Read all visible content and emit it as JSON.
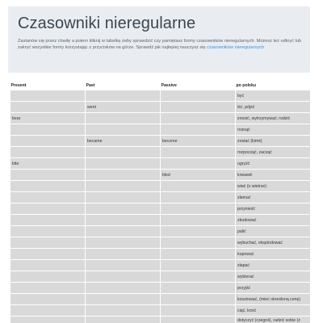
{
  "header": {
    "title": "Czasowniki nieregularne",
    "description": "Zastanów się przez chwilę a potem kliknij w tabelkę żeby sprawdzić czy pamiętasz formy czasowników nieregularnych. Możesz też odkryć lub zakryć wszystkie formy korzystając z przycisków na górze. Sprawdź jak najlepiej nauczysz się",
    "link_text": "czasowników nieregularnych"
  },
  "table": {
    "headers": [
      "Present",
      "Past",
      "Passive",
      "po polsku"
    ],
    "rows": [
      [
        "",
        "",
        "",
        "być"
      ],
      [
        "",
        "went",
        "",
        "iść, pójść"
      ],
      [
        "bear",
        "",
        "",
        "znosić, wytrzymywać; rodzić"
      ],
      [
        "",
        "",
        "",
        "rosnąć"
      ],
      [
        "",
        "became",
        "become",
        "zostać (kimś)"
      ],
      [
        "",
        "",
        "",
        "rozpocząć, zacząć"
      ],
      [
        "bite",
        "",
        "",
        "ugryźć"
      ],
      [
        "",
        "",
        "bled",
        "krwawić"
      ],
      [
        "",
        "",
        "",
        "wiać (o wietrze)"
      ],
      [
        "",
        "",
        "",
        "złamać"
      ],
      [
        "",
        "",
        "",
        "przynieść"
      ],
      [
        "",
        "",
        "",
        "zbudować"
      ],
      [
        "",
        "",
        "",
        "palić"
      ],
      [
        "",
        "",
        "",
        "wybuchać, eksplodować"
      ],
      [
        "",
        "",
        "",
        "kupować"
      ],
      [
        "",
        "",
        "",
        "złapać"
      ],
      [
        "",
        "",
        "",
        "wybierać"
      ],
      [
        "",
        "",
        "",
        "przyjść"
      ],
      [
        "",
        "",
        "",
        "kosztować, (mieć określoną cenę)"
      ],
      [
        "",
        "",
        "",
        "ciąć, kroić"
      ],
      [
        "",
        "",
        "",
        "dotyczyć (czegoś), radzić sobie (z czymś)"
      ]
    ]
  }
}
